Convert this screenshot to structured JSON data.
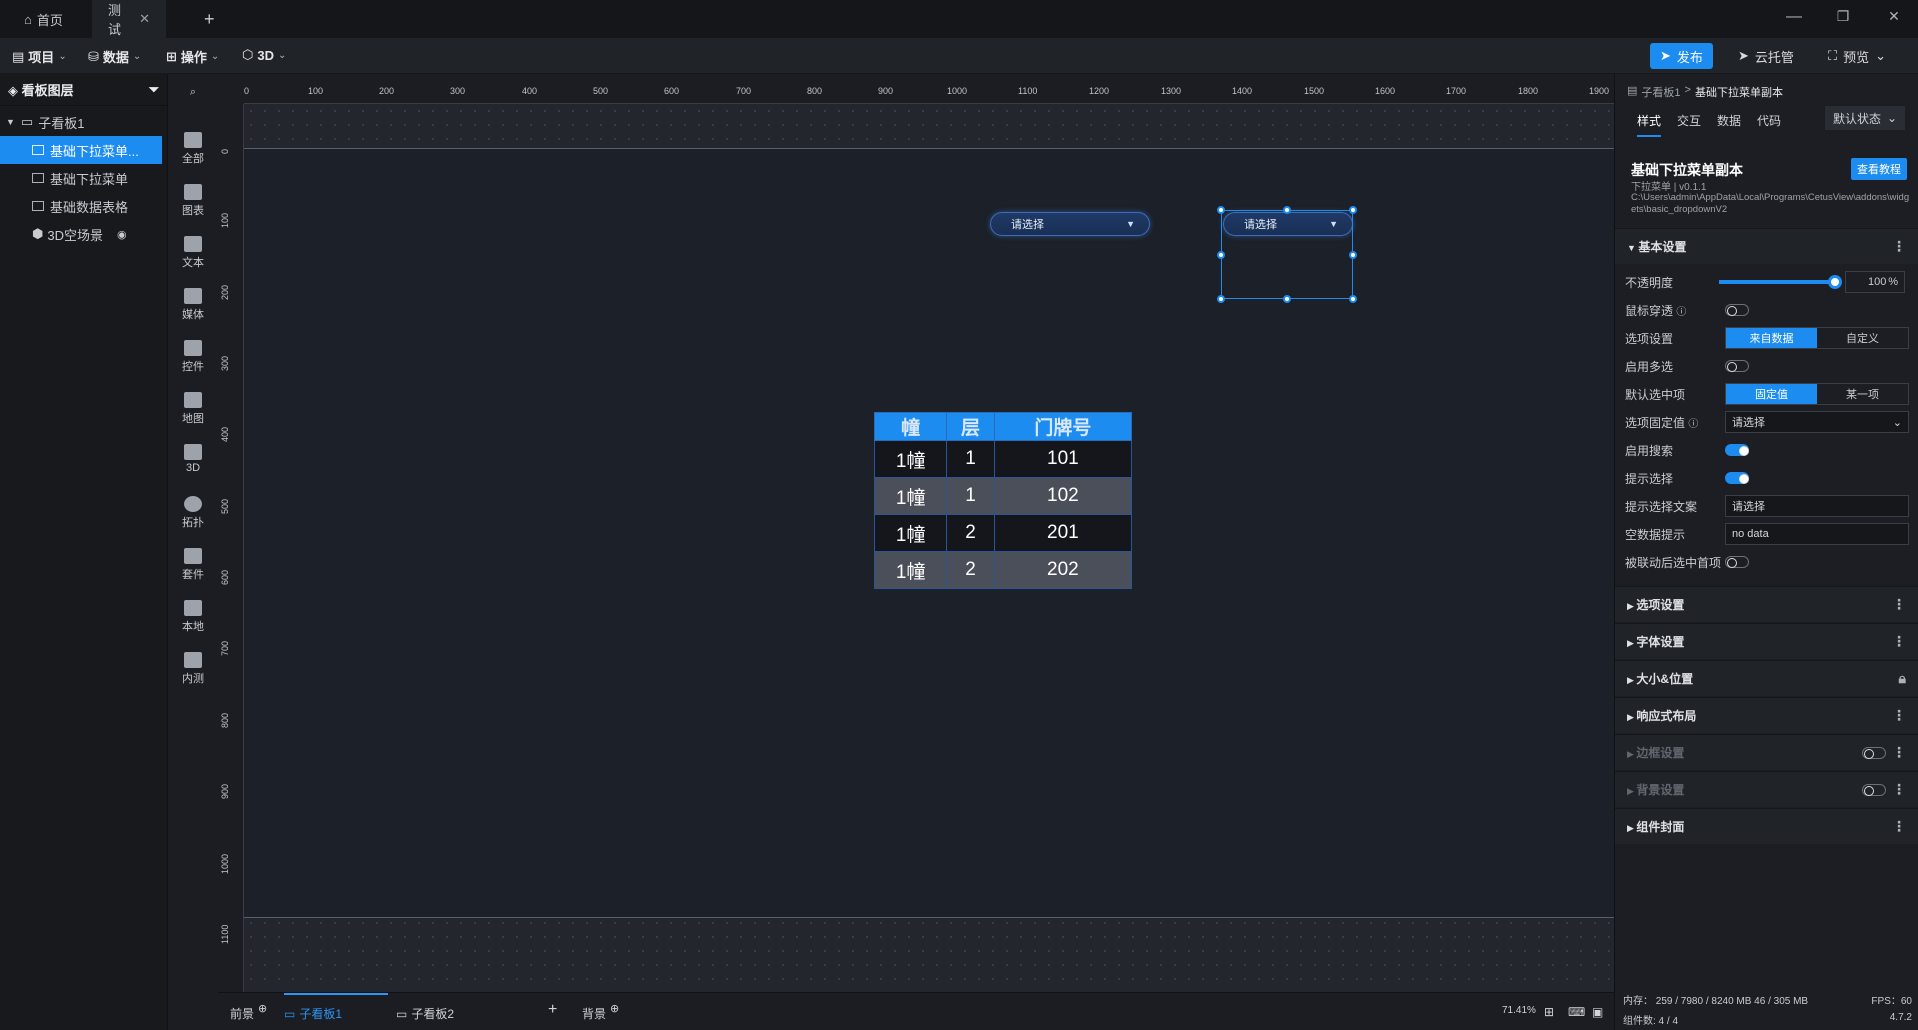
{
  "window": {
    "tabs": [
      {
        "label": "首页"
      },
      {
        "label": "测试"
      }
    ],
    "new_tab": "+",
    "controls": {
      "minimize": "—",
      "restore": "❐",
      "close": "✕"
    }
  },
  "menu": {
    "items": [
      {
        "label": "项目"
      },
      {
        "label": "数据"
      },
      {
        "label": "操作"
      },
      {
        "label": "3D"
      }
    ],
    "publish": "发布",
    "cloud": "云托管",
    "preview": "预览"
  },
  "layers": {
    "title": "看板图层",
    "root": "子看板1",
    "items": [
      {
        "label": "基础下拉菜单..."
      },
      {
        "label": "基础下拉菜单"
      },
      {
        "label": "基础数据表格"
      },
      {
        "label": "3D空场景"
      }
    ]
  },
  "tools": [
    {
      "label": "全部",
      "icon": "grid-icon"
    },
    {
      "label": "图表",
      "icon": "bar-chart-icon"
    },
    {
      "label": "文本",
      "icon": "text-icon"
    },
    {
      "label": "媒体",
      "icon": "media-icon"
    },
    {
      "label": "控件",
      "icon": "control-icon"
    },
    {
      "label": "地图",
      "icon": "map-icon"
    },
    {
      "label": "3D",
      "icon": "cube-icon"
    },
    {
      "label": "拓扑",
      "icon": "topology-icon"
    },
    {
      "label": "套件",
      "icon": "suite-icon"
    },
    {
      "label": "本地",
      "icon": "puzzle-icon"
    },
    {
      "label": "内测",
      "icon": "beta-icon"
    }
  ],
  "ruler": {
    "top": [
      "0",
      "100",
      "200",
      "300",
      "400",
      "500",
      "600",
      "700",
      "800",
      "900",
      "1000",
      "1100",
      "1200",
      "1300",
      "1400",
      "1500",
      "1600",
      "1700",
      "1800",
      "1900"
    ],
    "left": [
      "0",
      "100",
      "200",
      "300",
      "400",
      "500",
      "600",
      "700",
      "800",
      "900",
      "1000",
      "1100"
    ]
  },
  "canvas": {
    "dropdown1": {
      "placeholder": "请选择",
      "arrow": "▼"
    },
    "dropdown2": {
      "placeholder": "请选择",
      "arrow": "▼"
    },
    "table": {
      "headers": [
        "幢",
        "层",
        "门牌号"
      ],
      "rows": [
        [
          "1幢",
          "1",
          "101"
        ],
        [
          "1幢",
          "1",
          "102"
        ],
        [
          "1幢",
          "2",
          "201"
        ],
        [
          "1幢",
          "2",
          "202"
        ]
      ]
    }
  },
  "bottom": {
    "tabs": [
      {
        "label": "前景"
      },
      {
        "label": "子看板1"
      },
      {
        "label": "子看板2"
      },
      {
        "label": "背景"
      }
    ],
    "add": "+",
    "zoom": "71.41%"
  },
  "panel": {
    "breadcrumb_parent": "子看板1",
    "breadcrumb_sep": ">",
    "breadcrumb_current": "基础下拉菜单副本",
    "tabs": [
      {
        "label": "样式"
      },
      {
        "label": "交互"
      },
      {
        "label": "数据"
      },
      {
        "label": "代码"
      }
    ],
    "state_select": "默认状态",
    "title": "基础下拉菜单副本",
    "tutorial": "查看教程",
    "subtitle": "下拉菜单 | v0.1.1",
    "path": "C:\\Users\\admin\\AppData\\Local\\Programs\\CetusView\\addons\\widgets\\basic_dropdownV2",
    "basic_section": "基本设置",
    "opacity_label": "不透明度",
    "opacity_value": "100",
    "opacity_unit": "%",
    "opacity_fraction": 1.0,
    "pointer_label": "鼠标穿透",
    "option_label": "选项设置",
    "option_seg": [
      "来自数据",
      "自定义"
    ],
    "multi_label": "启用多选",
    "default_label": "默认选中项",
    "default_seg": [
      "固定值",
      "某一项"
    ],
    "fixed_label": "选项固定值",
    "fixed_value": "请选择",
    "search_label": "启用搜索",
    "hint_label": "提示选择",
    "hint_text_label": "提示选择文案",
    "hint_text_value": "请选择",
    "empty_label": "空数据提示",
    "empty_value": "no data",
    "linked_label": "被联动后选中首项",
    "sections": [
      {
        "label": "选项设置"
      },
      {
        "label": "字体设置"
      },
      {
        "label": "大小&位置"
      },
      {
        "label": "响应式布局"
      },
      {
        "label": "边框设置"
      },
      {
        "label": "背景设置"
      },
      {
        "label": "组件封面"
      }
    ],
    "memory": "内存： 259 / 7980 / 8240 MB  46 / 305 MB",
    "fps": "FPS：60",
    "widget_count": "组件数: 4 / 4",
    "version": "4.7.2"
  },
  "colors": {
    "accent": "#1d8cf0",
    "bg": "#1b1d22",
    "stage": "#1c2029"
  }
}
